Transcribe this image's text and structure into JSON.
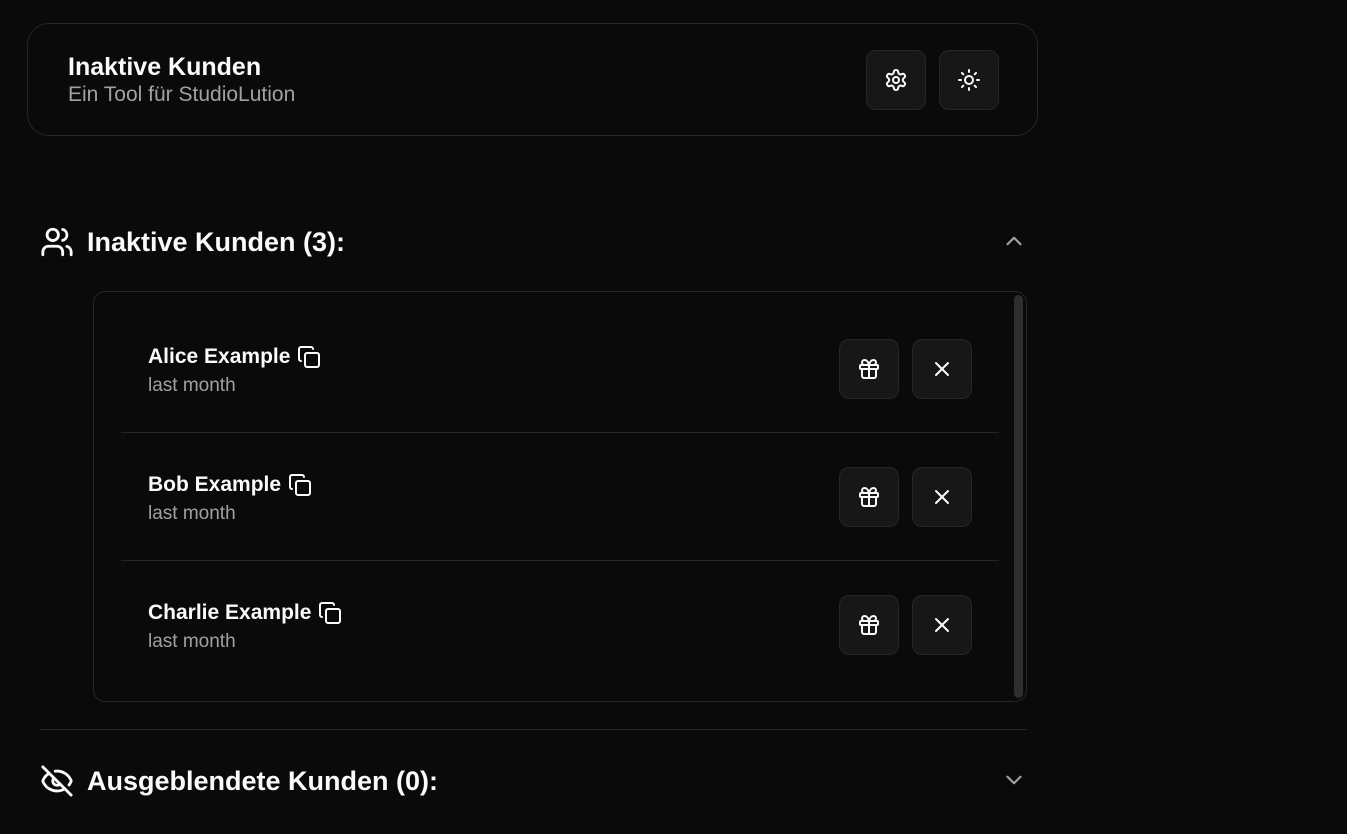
{
  "header": {
    "title": "Inaktive Kunden",
    "subtitle": "Ein Tool für StudioLution",
    "buttons": [
      {
        "icon": "gear-icon"
      },
      {
        "icon": "sun-icon"
      }
    ]
  },
  "sections": [
    {
      "title": "Inaktive Kunden (3):",
      "icon": "users-icon",
      "expanded": true,
      "customers": [
        {
          "name": "Alice Example",
          "last_active": "last month"
        },
        {
          "name": "Bob Example",
          "last_active": "last month"
        },
        {
          "name": "Charlie Example",
          "last_active": "last month"
        }
      ]
    },
    {
      "title": "Ausgeblendete Kunden (0):",
      "icon": "eye-off-icon",
      "expanded": false,
      "customers": []
    }
  ],
  "colors": {
    "background": "#0a0a0a",
    "border": "#262626",
    "button_bg": "#171717",
    "text": "#fafafa",
    "muted_text": "#a1a1a1"
  }
}
